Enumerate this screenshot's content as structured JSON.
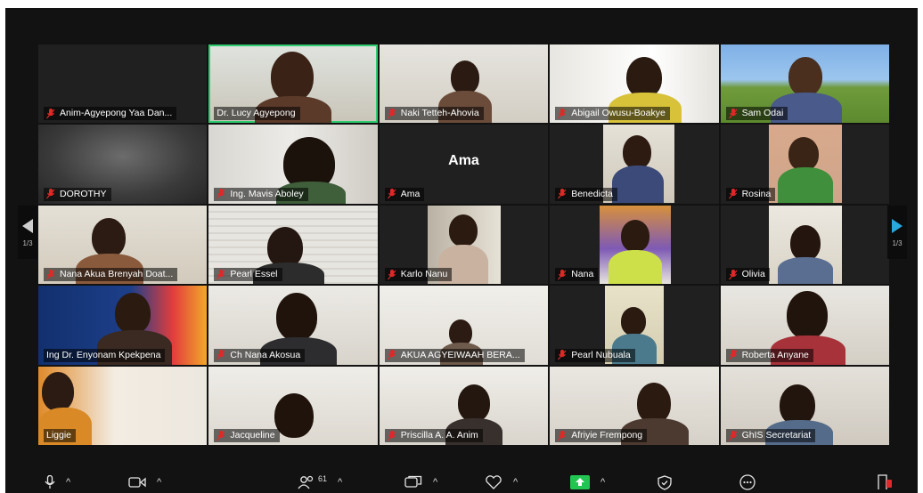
{
  "gallery": {
    "active_speaker": "Ama",
    "participants": [
      {
        "name": "Anim-Agyepong Yaa Dan...",
        "video": false
      },
      {
        "name": "Dr. Lucy Agyepong",
        "video": true
      },
      {
        "name": "Naki Tetteh-Ahovia",
        "video": true
      },
      {
        "name": "Abigail Owusu-Boakye",
        "video": true
      },
      {
        "name": "Sam Odai",
        "video": true
      },
      {
        "name": "DOROTHY",
        "video": true
      },
      {
        "name": "Ing. Mavis Aboley",
        "video": true
      },
      {
        "name": "Ama",
        "video": false
      },
      {
        "name": "Benedicta",
        "video": true
      },
      {
        "name": "Rosina",
        "video": true
      },
      {
        "name": "Nana Akua Brenyah Doat...",
        "video": true
      },
      {
        "name": "Pearl Essel",
        "video": true
      },
      {
        "name": "Karlo Nanu",
        "video": true
      },
      {
        "name": "Nana",
        "video": true
      },
      {
        "name": "Olivia",
        "video": true
      },
      {
        "name": "Ing Dr. Enyonam Kpekpena",
        "video": true
      },
      {
        "name": "Ch Nana Akosua",
        "video": true
      },
      {
        "name": "AKUA AGYEIWAAH BERA...",
        "video": true
      },
      {
        "name": "Pearl Nubuala",
        "video": true
      },
      {
        "name": "Roberta Anyane",
        "video": true
      },
      {
        "name": "Liggie",
        "video": true
      },
      {
        "name": "Jacqueline",
        "video": true
      },
      {
        "name": "Priscilla A. A. Anim",
        "video": true
      },
      {
        "name": "Afriyie Frempong",
        "video": true
      },
      {
        "name": "GhIS Secretariat",
        "video": true
      }
    ]
  },
  "pagination": {
    "prev_page": "1/3",
    "next_page": "1/3"
  },
  "toolbar": {
    "participants_count": "61",
    "icons": [
      "microphone-icon",
      "video-camera-icon",
      "participants-icon",
      "chat-icon",
      "reactions-icon",
      "share-screen-icon",
      "security-icon",
      "more-icon",
      "leave-icon"
    ]
  },
  "colors": {
    "background": "#121212",
    "mic_muted": "#e02828",
    "active_speaker": "#2ecc71",
    "share_green": "#23c552",
    "nav_arrow": "#29a8e0"
  }
}
